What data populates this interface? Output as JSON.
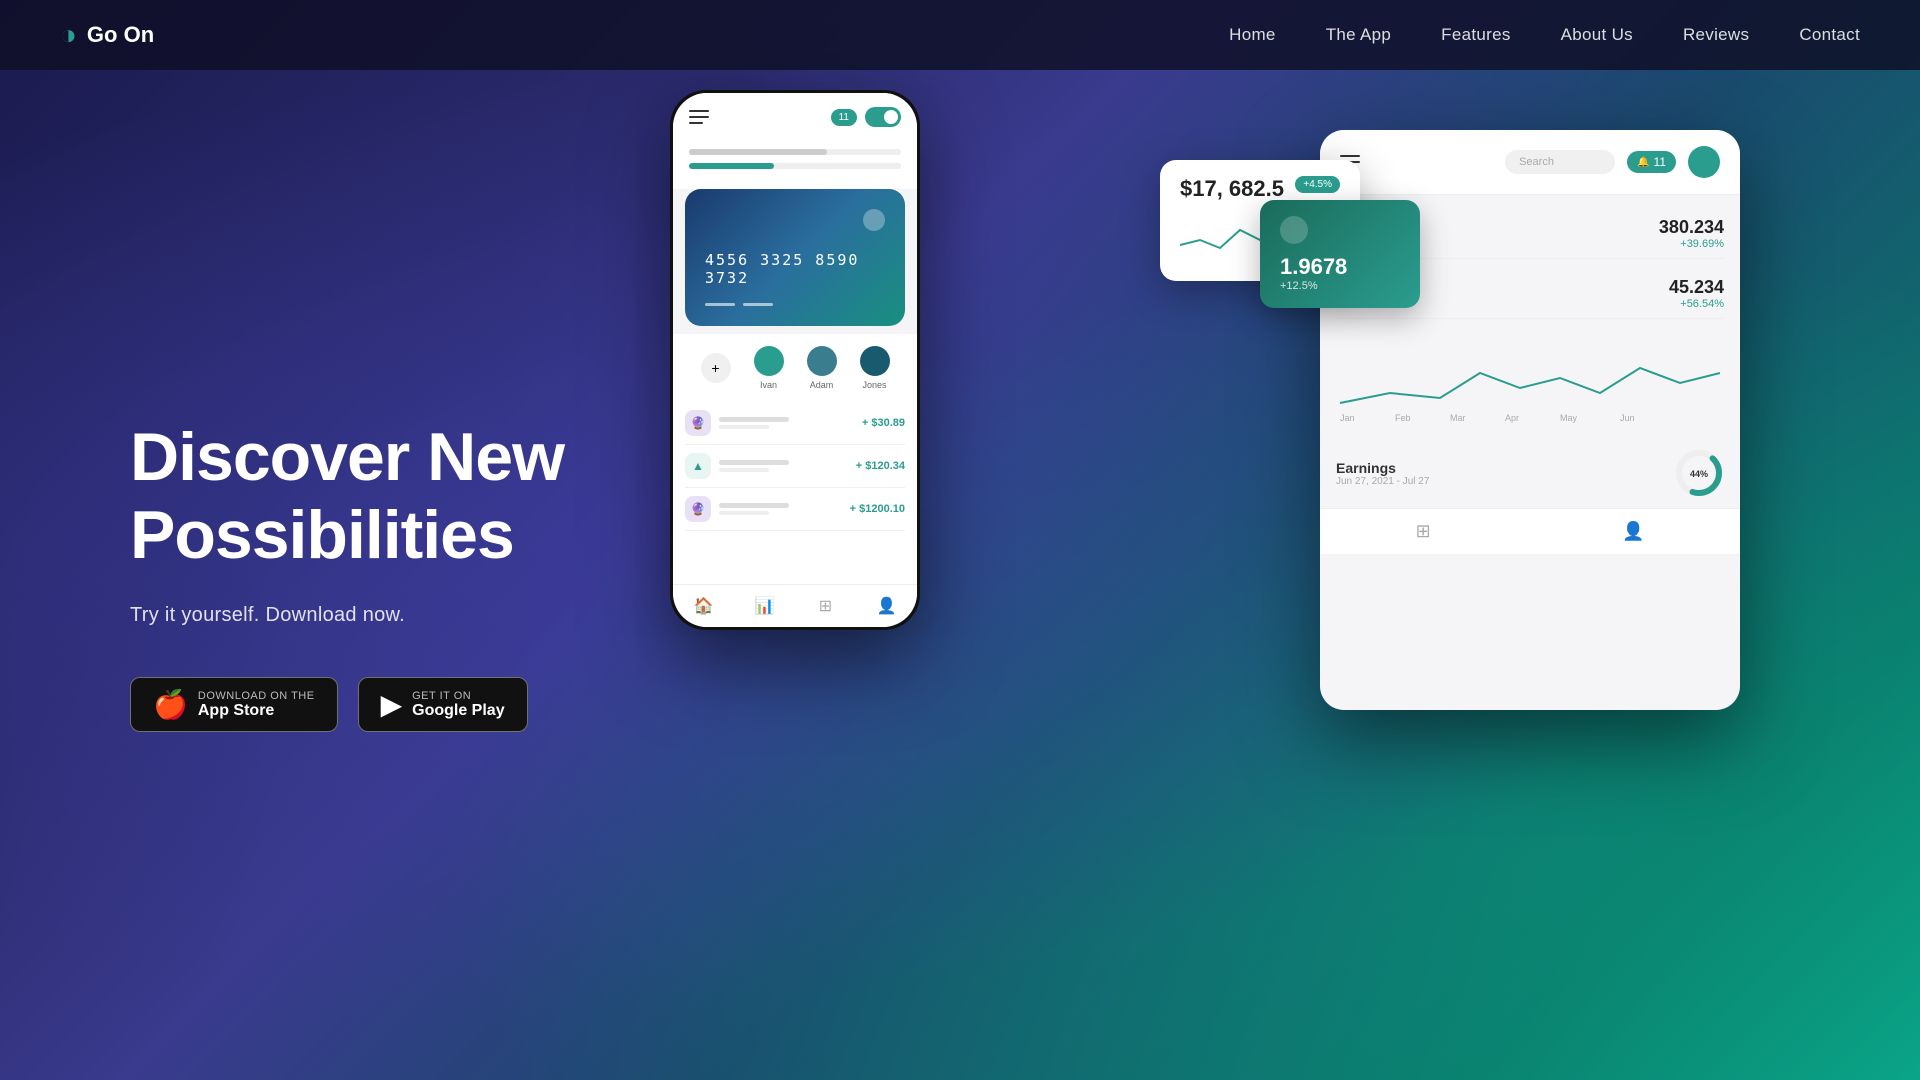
{
  "brand": {
    "name": "Go On",
    "logo_icon": "◑"
  },
  "nav": {
    "links": [
      {
        "label": "Home",
        "id": "home"
      },
      {
        "label": "The App",
        "id": "the-app"
      },
      {
        "label": "Features",
        "id": "features"
      },
      {
        "label": "About Us",
        "id": "about-us"
      },
      {
        "label": "Reviews",
        "id": "reviews"
      },
      {
        "label": "Contact",
        "id": "contact"
      }
    ]
  },
  "hero": {
    "title": "Discover New Possibilities",
    "subtitle": "Try it yourself. Download now.",
    "app_store_label_small": "Download on the",
    "app_store_label": "App Store",
    "google_play_label_small": "GET IT ON",
    "google_play_label": "Google Play"
  },
  "mockup": {
    "phone": {
      "badge": "11",
      "card_number": "4556 3325 8590 3732",
      "contacts": [
        "Ivan",
        "Adam",
        "Jones"
      ],
      "transactions": [
        {
          "amount": "+ $30.89"
        },
        {
          "amount": "+ $120.34"
        },
        {
          "amount": "+ $1200.10"
        }
      ]
    },
    "tablet": {
      "search_placeholder": "Search",
      "notif_count": "11",
      "stats": [
        {
          "value": "380.234",
          "change": "+39.69%"
        },
        {
          "value": "45.234",
          "change": "+56.54%"
        }
      ],
      "teal_card": {
        "value": "1.9678",
        "change": "+12.5%"
      },
      "floating_card": {
        "value": "$17, 682.5",
        "badge": "+4.5%"
      },
      "earnings": {
        "label": "Earnings",
        "date": "Jun 27, 2021 - Jul 27",
        "percent": "44%"
      },
      "chart_months": [
        "Jan",
        "Feb",
        "Mar",
        "Apr",
        "May",
        "Jun"
      ]
    }
  }
}
